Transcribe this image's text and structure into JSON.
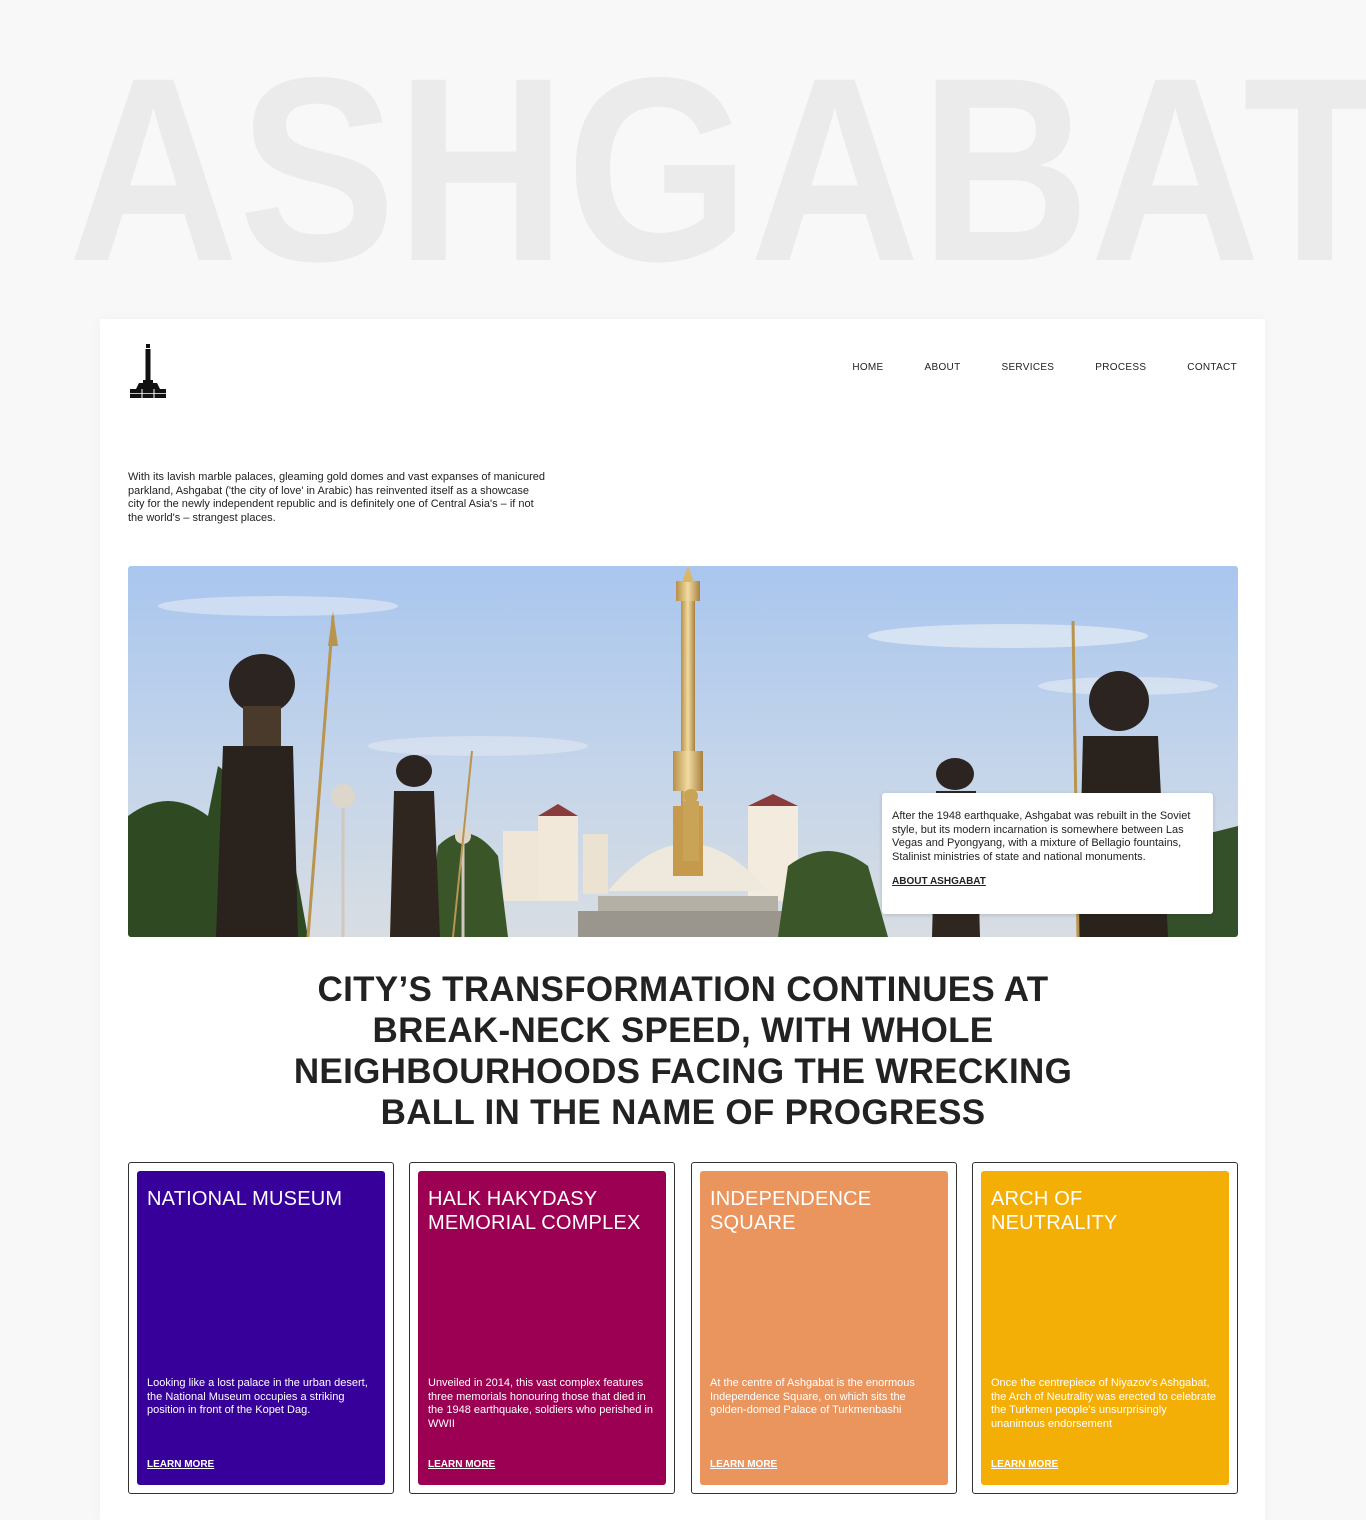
{
  "background_title": "ASHGABAT",
  "nav": {
    "items": [
      "HOME",
      "ABOUT",
      "SERVICES",
      "PROCESS",
      "CONTACT"
    ]
  },
  "intro": "With its lavish marble palaces, gleaming gold domes and vast expanses of manicured parkland, Ashgabat ('the city of love' in Arabic) has reinvented itself as a showcase city for the newly independent republic and is definitely one of Central Asia's – if not the world's – strangest places.",
  "hero": {
    "box_text": "After the 1948 earthquake, Ashgabat was rebuilt in the Soviet style, but its modern incarnation is somewhere between Las Vegas and Pyongyang, with a mixture of Bellagio fountains, Stalinist ministries of state and national monuments.",
    "box_link": "ABOUT ASHGABAT"
  },
  "headline": "CITY’S TRANSFORMATION CONTINUES AT BREAK-NECK SPEED, WITH WHOLE NEIGHBOURHOODS FACING THE WRECKING BALL IN THE NAME OF PROGRESS",
  "tiles": [
    {
      "title": "NATIONAL MUSEUM",
      "text": "Looking like a lost palace in the urban desert, the National Museum occupies a striking position in front of the Kopet Dag.",
      "link": "LEARN MORE",
      "color": "#37009a"
    },
    {
      "title": "HALK HAKYDASY MEMORIAL COMPLEX",
      "text": "Unveiled in 2014, this vast complex features three memorials honouring those that died in the 1948 earthquake, soldiers who perished in WWII",
      "link": "LEARN MORE",
      "color": "#9c0053"
    },
    {
      "title": "INDEPENDENCE SQUARE",
      "text": "At the centre of Ashgabat is the enormous Independence Square, on which sits the golden-domed Palace of Turkmenbashi",
      "link": "LEARN MORE",
      "color": "#e9955d"
    },
    {
      "title": "ARCH OF NEUTRALITY",
      "text": "Once the centrepiece of Niyazov's Ashgabat, the Arch of Neutrality was erected to celebrate the Turkmen people's unsurprisingly unanimous endorsement",
      "link": "LEARN MORE",
      "color": "#f3af05"
    }
  ]
}
